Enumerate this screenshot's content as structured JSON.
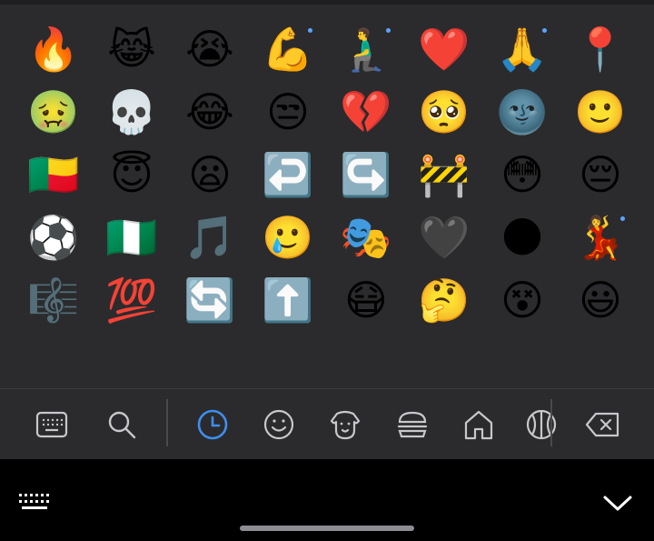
{
  "emoji_rows": [
    [
      {
        "char": "🔥",
        "name": "fire",
        "dot": false
      },
      {
        "char": "😹",
        "name": "cat-with-tears-of-joy",
        "dot": false
      },
      {
        "char": "😭",
        "name": "loudly-crying-face",
        "dot": false
      },
      {
        "char": "💪",
        "name": "flexed-biceps",
        "dot": true
      },
      {
        "char": "🧎‍♂️",
        "name": "man-kneeling",
        "dot": true
      },
      {
        "char": "❤️",
        "name": "red-heart",
        "dot": false
      },
      {
        "char": "🙏",
        "name": "folded-hands",
        "dot": true
      },
      {
        "char": "📍",
        "name": "round-pushpin",
        "dot": false
      }
    ],
    [
      {
        "char": "🤢",
        "name": "nauseated-face",
        "dot": false
      },
      {
        "char": "💀",
        "name": "skull",
        "dot": false
      },
      {
        "char": "😂",
        "name": "face-with-tears-of-joy",
        "dot": false
      },
      {
        "char": "😒",
        "name": "unamused-face",
        "dot": false
      },
      {
        "char": "💔",
        "name": "broken-heart",
        "dot": false
      },
      {
        "char": "🥺",
        "name": "pleading-face",
        "dot": false
      },
      {
        "char": "🌚",
        "name": "new-moon-face",
        "dot": false
      },
      {
        "char": "🙂",
        "name": "slightly-smiling-face",
        "dot": false
      }
    ],
    [
      {
        "char": "🇧🇯",
        "name": "flag-benin",
        "dot": false
      },
      {
        "char": "😇",
        "name": "smiling-face-with-halo",
        "dot": false
      },
      {
        "char": "😦",
        "name": "frowning-face-open-mouth",
        "dot": false
      },
      {
        "char": "↩️",
        "name": "left-arrow-curving",
        "dot": false
      },
      {
        "char": "↪️",
        "name": "right-arrow-curving",
        "dot": false
      },
      {
        "char": "🚧",
        "name": "construction",
        "dot": false
      },
      {
        "char": "😳",
        "name": "flushed-face",
        "dot": false
      },
      {
        "char": "😔",
        "name": "pensive-face",
        "dot": false
      }
    ],
    [
      {
        "char": "⚽",
        "name": "soccer-ball",
        "dot": false
      },
      {
        "char": "🇳🇬",
        "name": "flag-nigeria",
        "dot": false
      },
      {
        "char": "🎵",
        "name": "musical-note",
        "dot": false
      },
      {
        "char": "🥲",
        "name": "smiling-face-with-tear",
        "dot": false
      },
      {
        "char": "🎭",
        "name": "performing-arts",
        "dot": false
      },
      {
        "char": "🖤",
        "name": "black-heart",
        "dot": false
      },
      {
        "char": "🌑",
        "name": "new-moon",
        "dot": false
      },
      {
        "char": "💃",
        "name": "woman-dancing",
        "dot": true
      }
    ],
    [
      {
        "char": "🎼",
        "name": "musical-score",
        "dot": false
      },
      {
        "char": "💯",
        "name": "hundred-points",
        "dot": false
      },
      {
        "char": "🔄",
        "name": "counterclockwise-arrows",
        "dot": false
      },
      {
        "char": "⬆️",
        "name": "up-arrow",
        "dot": false
      },
      {
        "char": "😷",
        "name": "face-with-medical-mask",
        "dot": false
      },
      {
        "char": "🤔",
        "name": "thinking-face",
        "dot": false
      },
      {
        "char": "😵",
        "name": "dizzy-face",
        "dot": false
      },
      {
        "char": "😃",
        "name": "grinning-face-big-eyes",
        "dot": false
      }
    ]
  ],
  "toolbar": {
    "icons": [
      "keyboard-icon",
      "search-icon",
      "recent-clock-icon",
      "smiley-icon",
      "animal-icon",
      "food-icon",
      "home-icon",
      "sports-ball-icon",
      "backspace-icon"
    ],
    "active": "recent-clock-icon",
    "accent_color": "#3d8ef0",
    "icon_color": "#c7c7cc"
  },
  "navbar": {
    "icons": [
      "keyboard-grid-icon",
      "chevron-down-icon"
    ]
  }
}
